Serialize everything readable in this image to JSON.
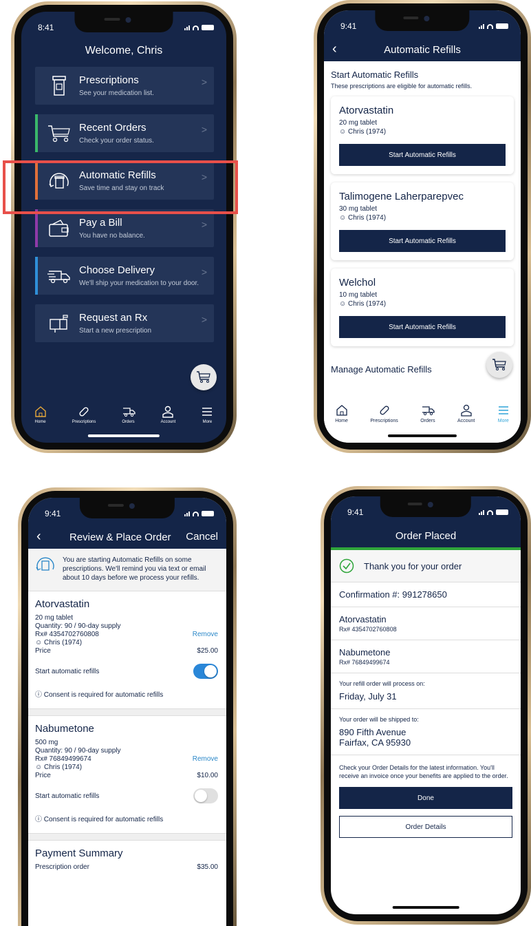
{
  "status_time": "9:41",
  "status_time_alt": "8:41",
  "screen1": {
    "title": "Welcome, Chris",
    "menu": [
      {
        "title": "Prescriptions",
        "sub": "See your medication list.",
        "strip": ""
      },
      {
        "title": "Recent Orders",
        "sub": "Check your order status.",
        "strip": "#3ab86a"
      },
      {
        "title": "Automatic Refills",
        "sub": "Save time and stay on track",
        "strip": "#e0703a"
      },
      {
        "title": "Pay a Bill",
        "sub": "You have no balance.",
        "strip": "#8f3aa8"
      },
      {
        "title": "Choose Delivery",
        "sub": "We'll ship your medication to your door.",
        "strip": "#2f8fd8"
      },
      {
        "title": "Request an Rx",
        "sub": "Start a new prescription",
        "strip": ""
      }
    ],
    "tabs": [
      "Home",
      "Prescriptions",
      "Orders",
      "Account",
      "More"
    ]
  },
  "screen2": {
    "title": "Automatic Refills",
    "section_title": "Start Automatic Refills",
    "section_sub": "These prescriptions are eligible for automatic refills.",
    "cards": [
      {
        "name": "Atorvastatin",
        "dose": "20 mg tablet",
        "patient": "Chris (1974)",
        "button": "Start Automatic Refills"
      },
      {
        "name": "Talimogene Laherparepvec",
        "dose": "30 mg tablet",
        "patient": "Chris (1974)",
        "button": "Start Automatic Refills"
      },
      {
        "name": "Welchol",
        "dose": "10 mg tablet",
        "patient": "Chris (1974)",
        "button": "Start Automatic Refills"
      }
    ],
    "manage_title": "Manage Automatic Refills",
    "tabs": [
      "Home",
      "Prescriptions",
      "Orders",
      "Account",
      "More"
    ]
  },
  "screen3": {
    "title": "Review & Place Order",
    "cancel": "Cancel",
    "notice": "You are starting Automatic Refills on some prescriptions. We'll remind you via text or email about 10 days before we process your refills.",
    "items": [
      {
        "name": "Atorvastatin",
        "dose": "20 mg tablet",
        "qty": "Quantity: 90 / 90-day supply",
        "rx": "Rx# 4354702760808",
        "remove": "Remove",
        "patient": "Chris (1974)",
        "price_label": "Price",
        "price": "$25.00",
        "toggle_label": "Start automatic refills",
        "consent": "Consent is required for automatic refills",
        "toggle_on": true
      },
      {
        "name": "Nabumetone",
        "dose": "500 mg",
        "qty": "Quantity: 90 / 90-day supply",
        "rx": "Rx# 76849499674",
        "remove": "Remove",
        "patient": "Chris (1974)",
        "price_label": "Price",
        "price": "$10.00",
        "toggle_label": "Start automatic refills",
        "consent": "Consent is required for automatic refills",
        "toggle_on": false
      }
    ],
    "payment_title": "Payment Summary",
    "payment_label": "Prescription order",
    "payment_value": "$35.00"
  },
  "screen4": {
    "title": "Order Placed",
    "thanks": "Thank you for your order",
    "confirmation": "Confirmation #: 991278650",
    "items": [
      {
        "name": "Atorvastatin",
        "rx": "Rx# 4354702760808"
      },
      {
        "name": "Nabumetone",
        "rx": "Rx# 76849499674"
      }
    ],
    "process_label": "Your refill order will process on:",
    "process_date": "Friday, July 31",
    "ship_label": "Your order will be shipped to:",
    "ship_line1": "890 Fifth Avenue",
    "ship_line2": "Fairfax, CA 95930",
    "info": "Check your Order Details for the latest information. You'll receive an invoice once your benefits are applied to the order.",
    "done": "Done",
    "details": "Order Details"
  }
}
